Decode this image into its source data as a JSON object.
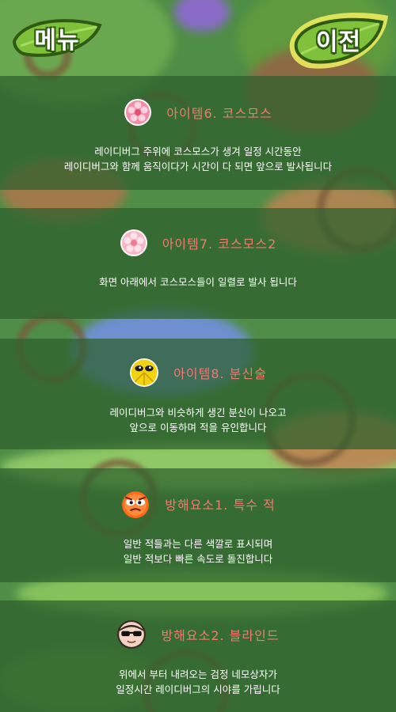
{
  "header": {
    "menu_label": "메뉴",
    "prev_label": "이전"
  },
  "items": [
    {
      "title": "아이템6. 코스모스",
      "icon": "pink-cosmos-flower-icon",
      "desc": [
        "레이디버그 주위에 코스모스가 생겨 일정 시간동안",
        "레이디버그와 함께 움직이다가 시간이 다 되면 앞으로 발사됩니다"
      ]
    },
    {
      "title": "아이템7. 코스모스2",
      "icon": "light-pink-cosmos-flower-icon",
      "desc": [
        "화면 아래에서 코스모스들이 일렬로 발사 됩니다"
      ]
    },
    {
      "title": "아이템8. 분신술",
      "icon": "yellow-ladybug-clone-icon",
      "desc": [
        "레이디버그와 비슷하게 생긴 분신이 나오고",
        "앞으로 이동하며 적을 유인합니다"
      ]
    },
    {
      "title": "방해요소1. 특수 적",
      "icon": "red-special-enemy-icon",
      "desc": [
        "일반 적들과는 다른 색깔로 표시되며",
        "일반 적보다 빠른 속도로 돌진합니다"
      ]
    },
    {
      "title": "방해요소2. 블라인드",
      "icon": "sunglasses-blind-icon",
      "desc": [
        "위에서 부터 내려오는 검정 네모상자가",
        "일정시간 레이디버그의 시야를 가립니다"
      ]
    }
  ],
  "colors": {
    "title_text": "#f07a6e",
    "panel_bg": "rgba(45,95,45,0.72)",
    "desc_text": "#ffffff",
    "leaf_green": "#7fc13a"
  }
}
